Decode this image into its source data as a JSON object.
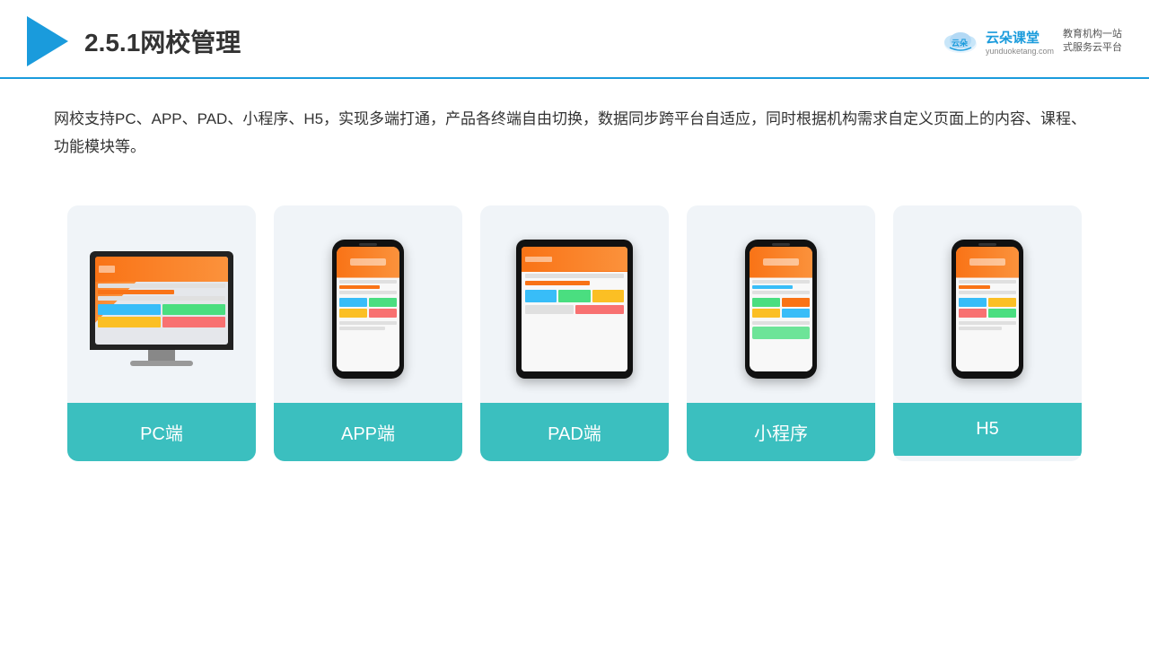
{
  "header": {
    "title": "2.5.1网校管理",
    "brand": {
      "name": "云朵课堂",
      "domain": "yunduoketang.com",
      "slogan": "教育机构一站\n式服务云平台"
    }
  },
  "description": {
    "text": "网校支持PC、APP、PAD、小程序、H5，实现多端打通，产品各终端自由切换，数据同步跨平台自适应，同时根据机构需求自定义页面上的内容、课程、功能模块等。"
  },
  "cards": [
    {
      "id": "pc",
      "label": "PC端",
      "device": "pc"
    },
    {
      "id": "app",
      "label": "APP端",
      "device": "phone"
    },
    {
      "id": "pad",
      "label": "PAD端",
      "device": "tablet"
    },
    {
      "id": "miniapp",
      "label": "小程序",
      "device": "phone2"
    },
    {
      "id": "h5",
      "label": "H5",
      "device": "phone3"
    }
  ],
  "accent_color": "#3bbfbf"
}
